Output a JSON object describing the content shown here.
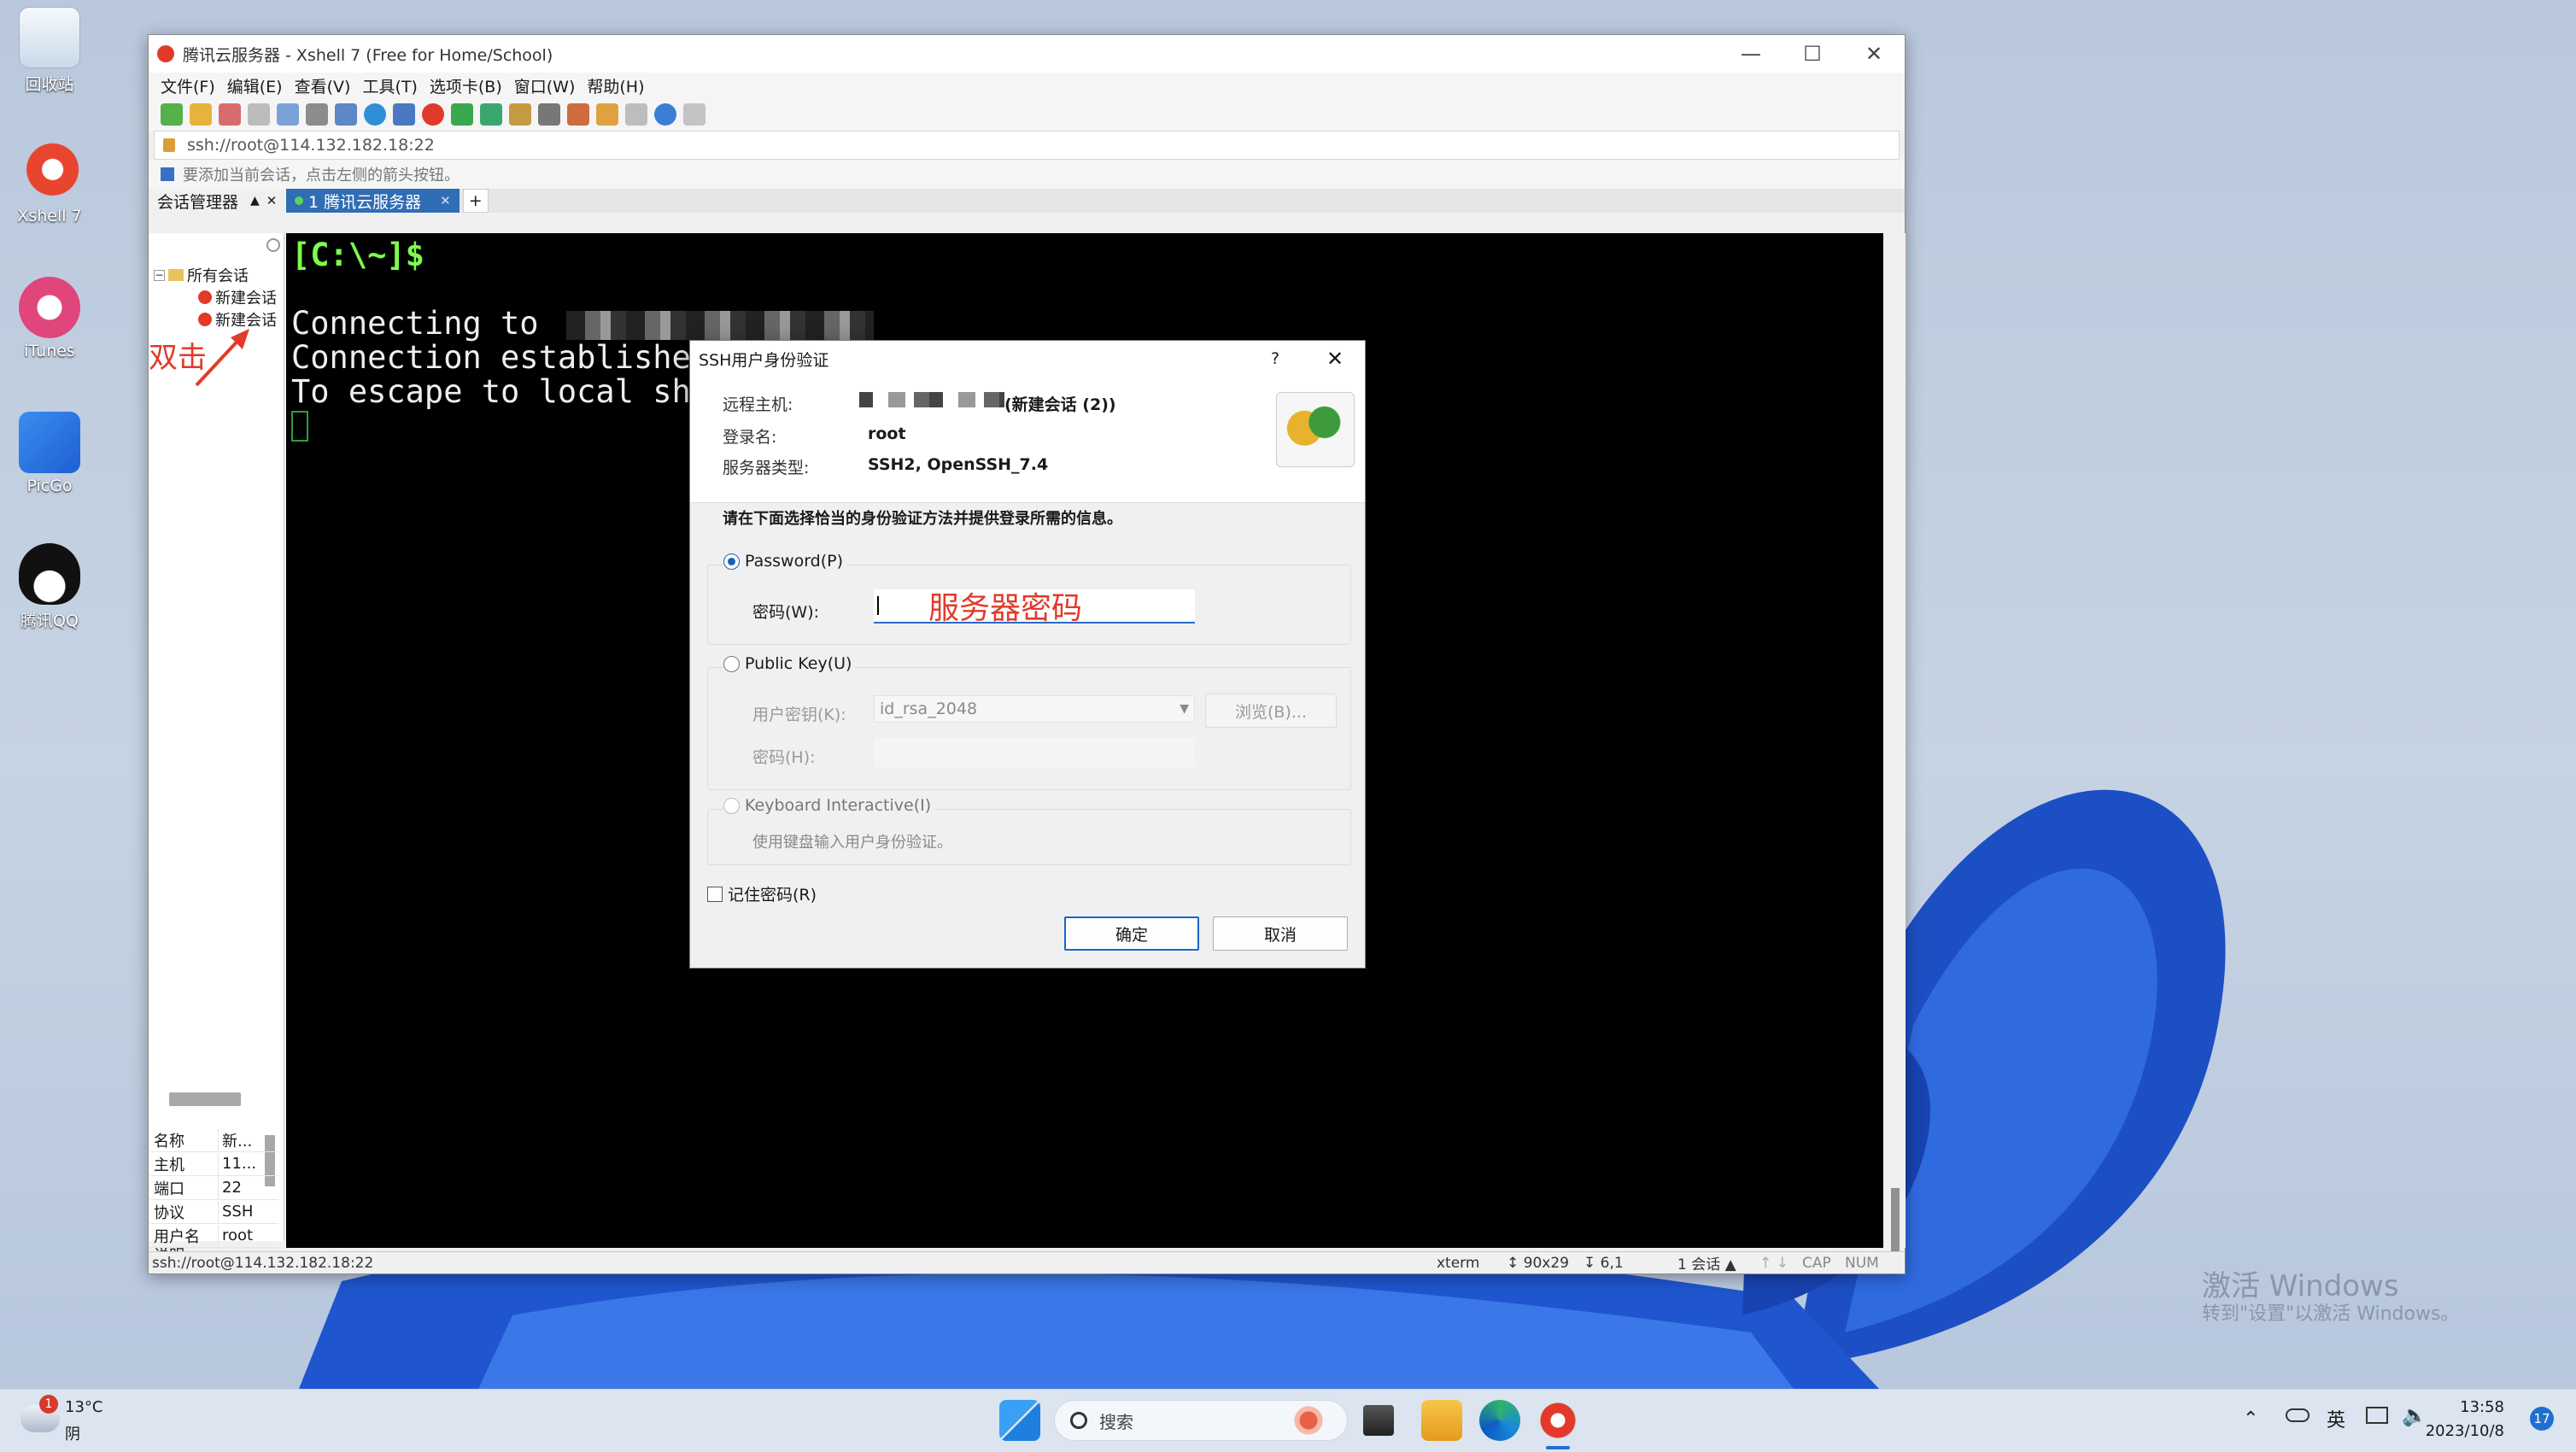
{
  "desktop": {
    "icons": [
      {
        "label": "回收站",
        "icon": "recycle-bin-icon"
      },
      {
        "label": "Xshell 7",
        "icon": "xshell-icon"
      },
      {
        "label": "iTunes",
        "icon": "itunes-icon"
      },
      {
        "label": "PicGo",
        "icon": "picgo-icon"
      },
      {
        "label": "腾讯QQ",
        "icon": "qq-icon"
      }
    ],
    "watermark_line1": "激活 Windows",
    "watermark_line2": "转到\"设置\"以激活 Windows。"
  },
  "window": {
    "title": "腾讯云服务器 - Xshell 7 (Free for Home/School)",
    "menu": [
      "文件(F)",
      "编辑(E)",
      "查看(V)",
      "工具(T)",
      "选项卡(B)",
      "窗口(W)",
      "帮助(H)"
    ],
    "address": "ssh://root@114.132.182.18:22",
    "hint": "要添加当前会话，点击左侧的箭头按钮。",
    "session_manager_tab": "会话管理器",
    "active_tab": "1 腾讯云服务器",
    "tree": {
      "root": "所有会话",
      "items": [
        "新建会话",
        "新建会话"
      ]
    },
    "annotation": "双击",
    "properties": [
      {
        "k": "名称",
        "v": "新..."
      },
      {
        "k": "主机",
        "v": "11..."
      },
      {
        "k": "端口",
        "v": "22"
      },
      {
        "k": "协议",
        "v": "SSH"
      },
      {
        "k": "用户名",
        "v": "root"
      },
      {
        "k": "说明",
        "v": ""
      }
    ],
    "terminal": {
      "prompt": "[C:\\~]$",
      "lines": [
        "Connecting to",
        "Connection established.",
        "To escape to local shel"
      ]
    },
    "status": {
      "left": "ssh://root@114.132.182.18:22",
      "term": "xterm",
      "size": "90x29",
      "pos": "6,1",
      "sessions": "1 会话",
      "cap": "CAP",
      "num": "NUM"
    }
  },
  "dialog": {
    "title": "SSH用户身份验证",
    "help": "?",
    "remote_host_label": "远程主机:",
    "remote_host_value": "(新建会话 (2))",
    "login_label": "登录名:",
    "login_value": "root",
    "server_type_label": "服务器类型:",
    "server_type_value": "SSH2, OpenSSH_7.4",
    "instruction": "请在下面选择恰当的身份验证方法并提供登录所需的信息。",
    "password_option": "Password(P)",
    "password_label": "密码(W):",
    "password_annotation": "服务器密码",
    "publickey_option": "Public Key(U)",
    "user_key_label": "用户密钥(K):",
    "user_key_value": "id_rsa_2048",
    "browse_button": "浏览(B)...",
    "passphrase_label": "密码(H):",
    "keyboard_option": "Keyboard Interactive(I)",
    "keyboard_desc": "使用键盘输入用户身份验证。",
    "remember_label": "记住密码(R)",
    "ok_button": "确定",
    "cancel_button": "取消"
  },
  "taskbar": {
    "weather_temp": "13°C",
    "weather_desc": "阴",
    "weather_badge": "1",
    "search_placeholder": "搜索",
    "ime": "英",
    "time": "13:58",
    "date": "2023/10/8",
    "notif_count": "17"
  },
  "colors": {
    "accent": "#2f6db5",
    "annotation_red": "#e23a2a",
    "terminal_bg": "#000000",
    "prompt_green": "#7cfc4a"
  }
}
